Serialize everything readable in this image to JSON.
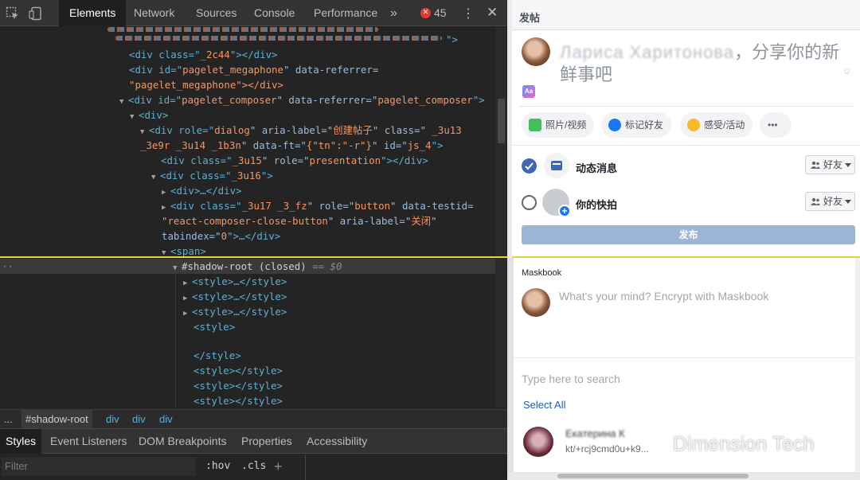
{
  "devtools": {
    "toolbar": {
      "tabs": [
        "Elements",
        "Network",
        "Sources",
        "Console",
        "Performance"
      ],
      "more": "»",
      "error_count": "45",
      "menu_icon": "⋮",
      "close_icon": "✕"
    },
    "dom_tree": [
      {
        "a": "<div class=\"",
        "b": "_2c44",
        "c": "\"></div>"
      },
      {
        "a": "<div id=\"",
        "b": "pagelet_megaphone",
        "c": "\" data-referrer=",
        "d": "\"pagelet_megaphone\"></div>"
      },
      {
        "a": "<div id=\"",
        "b": "pagelet_composer",
        "c": "\" data-referrer=\"",
        "d": "pagelet_composer",
        "e": "\">"
      },
      {
        "a": "<div>"
      },
      {
        "a": "<div role=\"",
        "b": "dialog",
        "c": "\" aria-label=\"",
        "d": "创建帖子",
        "e": "\" class=\"",
        "f": " _3u13"
      },
      {
        "a": "_3e9r _3u14 _1b3n",
        "b": "\" data-ft=\"",
        "c": "{\"tn\":\"-r\"}",
        "d": "\" id=\"",
        "e": "js_4",
        "f": "\">"
      },
      {
        "a": "<div class=\"",
        "b": "_3u15",
        "c": "\" role=\"",
        "d": "presentation",
        "e": "\"></div>"
      },
      {
        "a": "<div class=\"",
        "b": "_3u16",
        "c": "\">"
      },
      {
        "a": "<div>…</div>"
      },
      {
        "a": "<div class=\"",
        "b": "_3u17 _3_fz",
        "c": "\" role=\"",
        "d": "button",
        "e": "\" data-testid="
      },
      {
        "a": "\"react-composer-close-button",
        "b": "\" aria-label=\"",
        "c": "关闭",
        "d": "\""
      },
      {
        "a": "tabindex=\"",
        "b": "0",
        "c": "\">…</div>"
      },
      {
        "a": "<span>"
      },
      {
        "a": "#shadow-root (closed)",
        "b": " == $0"
      },
      {
        "a": "<style>…</style>"
      },
      {
        "a": "<style>…</style>"
      },
      {
        "a": "<style>…</style>"
      },
      {
        "a": "<style>"
      },
      {
        "a": "</style>"
      },
      {
        "a": "<style></style>"
      },
      {
        "a": "<style></style>"
      },
      {
        "a": "<style></style>"
      }
    ],
    "breadcrumbs": [
      "...",
      "#shadow-root",
      "div",
      "div",
      "div"
    ],
    "sub_tabs": [
      "Styles",
      "Event Listeners",
      "DOM Breakpoints",
      "Properties",
      "Accessibility"
    ],
    "filter": {
      "placeholder": "Filter",
      "hov": ":hov",
      "cls": ".cls",
      "plus": "+"
    }
  },
  "composer": {
    "title": "发帖",
    "prompt_suffix": "，分享你的新鲜事吧",
    "aa_icon": "Aa",
    "actions": [
      {
        "label": "照片/视频",
        "icon": "photo-video-icon",
        "color": "#45bd62"
      },
      {
        "label": "标记好友",
        "icon": "tag-friends-icon",
        "color": "#1877f2"
      },
      {
        "label": "感受/活动",
        "icon": "feeling-activity-icon",
        "color": "#f7b928"
      },
      {
        "label": "•••",
        "icon": "more-options-icon"
      }
    ],
    "destinations": [
      {
        "label": "动态消息",
        "checked": true,
        "audience": "好友"
      },
      {
        "label": "你的快拍",
        "checked": false,
        "audience": "好友"
      }
    ],
    "post_button": "发布"
  },
  "maskbook": {
    "title": "Maskbook",
    "prompt": "What's your mind? Encrypt with Maskbook",
    "search_placeholder": "Type here to search",
    "select_all": "Select All",
    "contact_key": "kt/+rcj9cmd0u+k9..."
  },
  "watermark": "Dimension Tech",
  "colors": {
    "facebook_blue": "#1877f2",
    "post_disabled": "#9cb4d8",
    "devtools_tag": "#5db0d7",
    "devtools_attr_value": "#f29766",
    "highlight_line": "#e4d63c"
  }
}
